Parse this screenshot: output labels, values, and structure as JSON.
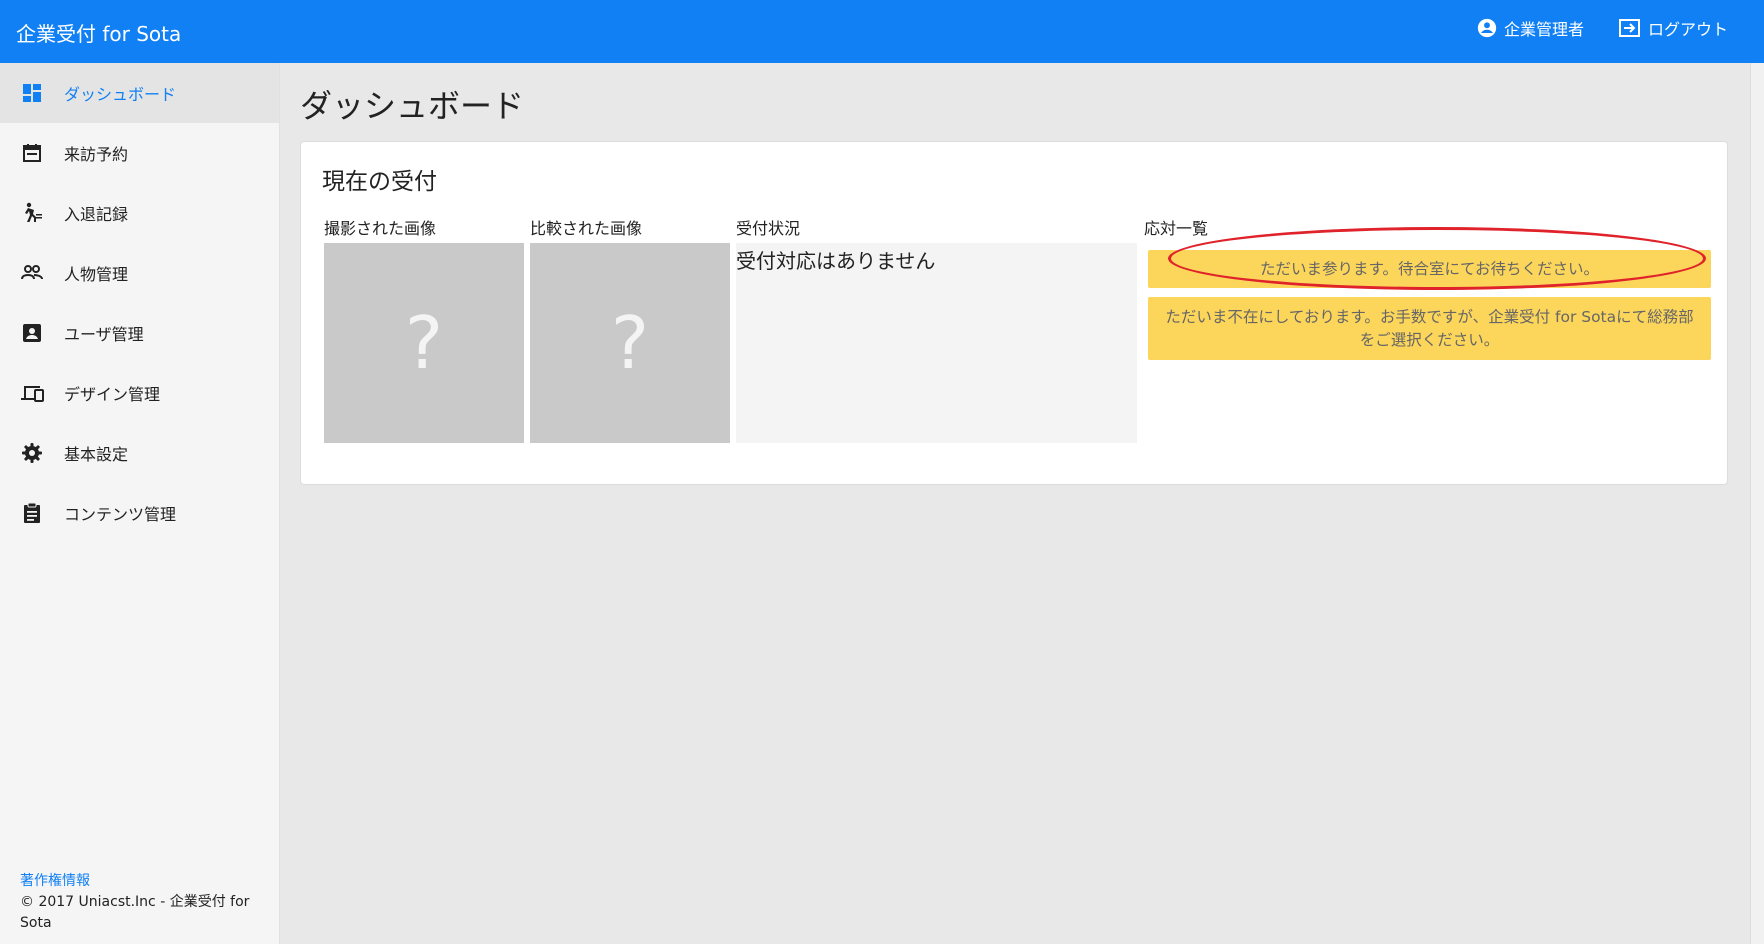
{
  "app": {
    "title": "企業受付 for Sota"
  },
  "header": {
    "user_label": "企業管理者",
    "logout_label": "ログアウト"
  },
  "sidebar": {
    "items": [
      {
        "label": "ダッシュボード",
        "icon": "dashboard-icon",
        "active": true
      },
      {
        "label": "来訪予約",
        "icon": "calendar-icon",
        "active": false
      },
      {
        "label": "入退記録",
        "icon": "walking-person-icon",
        "active": false
      },
      {
        "label": "人物管理",
        "icon": "people-icon",
        "active": false
      },
      {
        "label": "ユーザ管理",
        "icon": "account-box-icon",
        "active": false
      },
      {
        "label": "デザイン管理",
        "icon": "devices-icon",
        "active": false
      },
      {
        "label": "基本設定",
        "icon": "gear-icon",
        "active": false
      },
      {
        "label": "コンテンツ管理",
        "icon": "clipboard-icon",
        "active": false
      }
    ],
    "footer": {
      "copyright_link": "著作権情報",
      "copyright_text": "© 2017 Uniacst.Inc - 企業受付 for Sota"
    }
  },
  "main": {
    "page_title": "ダッシュボード",
    "card": {
      "title": "現在の受付",
      "columns": {
        "captured": "撮影された画像",
        "compared": "比較された画像",
        "status": "受付状況",
        "responses": "応対一覧"
      },
      "placeholder_glyph": "?",
      "status_text": "受付対応はありません",
      "responses": [
        "ただいま参ります。待合室にてお待ちください。",
        "ただいま不在にしております。お手数ですが、企業受付 for Sotaにて総務部をご選択ください。"
      ]
    }
  },
  "colors": {
    "header": "#1180f4",
    "response_button": "#fcd55b",
    "highlight": "#e0222a",
    "image_placeholder": "#c9c9c9"
  }
}
